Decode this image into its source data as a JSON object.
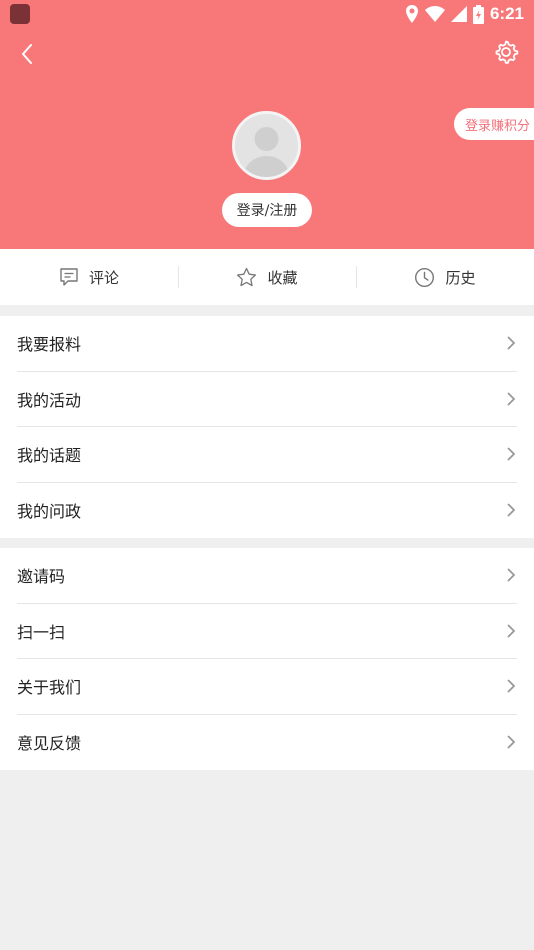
{
  "status": {
    "time": "6:21"
  },
  "header": {
    "login_label": "登录/注册",
    "points_label": "登录赚积分",
    "accent_color": "#f8787a"
  },
  "quick_actions": [
    {
      "label": "评论",
      "icon": "comment-icon"
    },
    {
      "label": "收藏",
      "icon": "star-icon"
    },
    {
      "label": "历史",
      "icon": "clock-icon"
    }
  ],
  "menu_groups": [
    {
      "items": [
        {
          "label": "我要报料"
        },
        {
          "label": "我的活动"
        },
        {
          "label": "我的话题"
        },
        {
          "label": "我的问政"
        }
      ]
    },
    {
      "items": [
        {
          "label": "邀请码"
        },
        {
          "label": "扫一扫"
        },
        {
          "label": "关于我们"
        },
        {
          "label": "意见反馈"
        }
      ]
    }
  ]
}
